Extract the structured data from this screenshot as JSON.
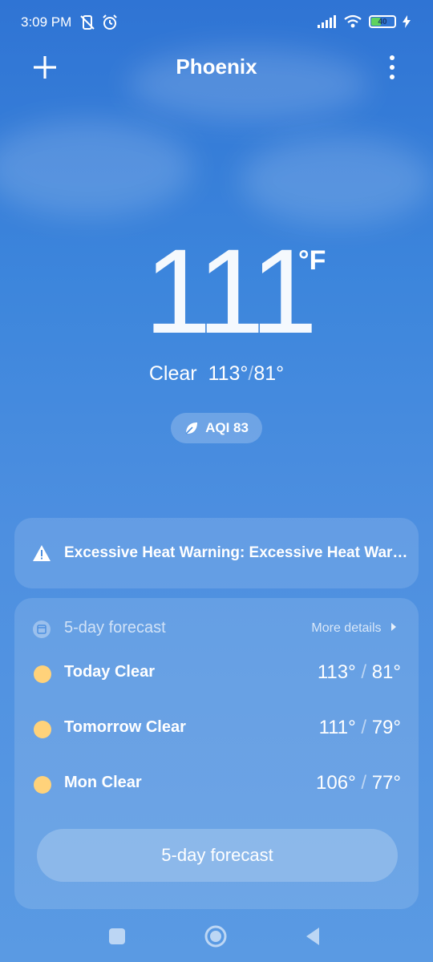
{
  "status_bar": {
    "time": "3:09 PM",
    "battery_level": "40",
    "battery_fraction": 0.4,
    "icons": [
      "mute-vibrate-icon",
      "alarm-icon",
      "signal-icon",
      "wifi-icon",
      "battery-icon",
      "charging-icon"
    ]
  },
  "header": {
    "city": "Phoenix"
  },
  "current": {
    "temperature": "111",
    "unit": "°F",
    "condition": "Clear",
    "high": "113°",
    "low": "81°",
    "aqi": "AQI 83"
  },
  "alert": {
    "text": "Excessive Heat Warning: Excessive Heat Warning in effect"
  },
  "forecast": {
    "title": "5-day forecast",
    "more_label": "More details",
    "days": [
      {
        "label": "Today  Clear",
        "high": "113°",
        "low": "81°"
      },
      {
        "label": "Tomorrow  Clear",
        "high": "111°",
        "low": "79°"
      },
      {
        "label": "Mon  Clear",
        "high": "106°",
        "low": "77°"
      }
    ],
    "button_label": "5-day forecast"
  },
  "colors": {
    "sun": "#ffd27a",
    "battery_fill": "#5fd35f"
  }
}
